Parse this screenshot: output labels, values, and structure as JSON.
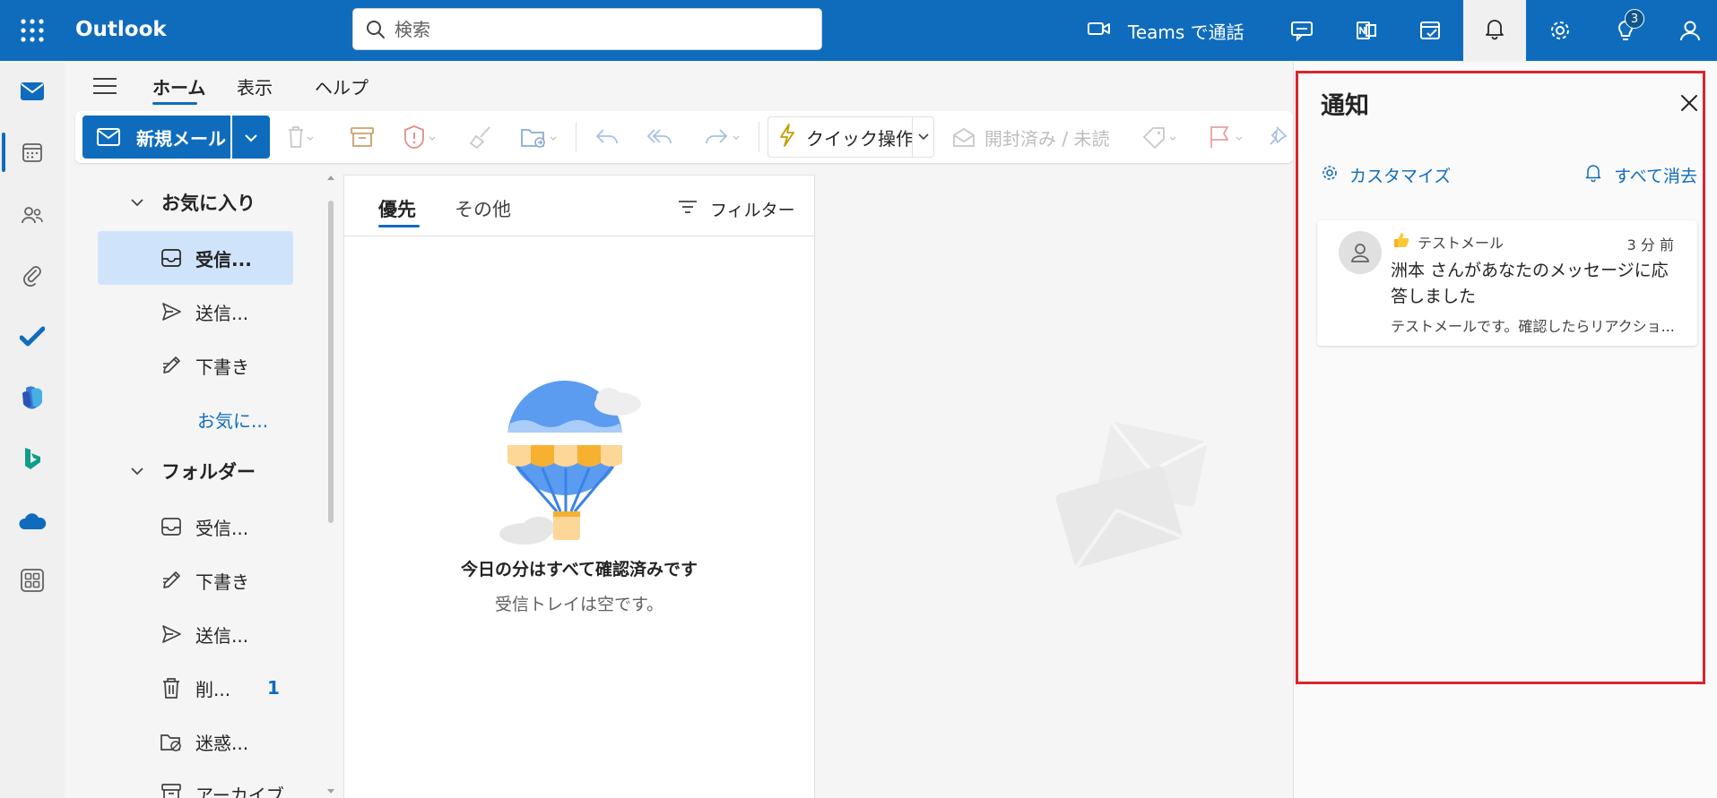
{
  "topbar": {
    "app_name": "Outlook",
    "search_placeholder": "検索",
    "teams_label": "Teams で通話",
    "tips_badge_count": "3",
    "accent_color": "#0f6cbd"
  },
  "ribbon": {
    "tabs": [
      {
        "label": "ホーム",
        "active": true
      },
      {
        "label": "表示",
        "active": false
      },
      {
        "label": "ヘルプ",
        "active": false
      }
    ],
    "new_mail_label": "新規メール",
    "quick_steps_label": "クイック操作",
    "read_unread_label": "開封済み / 未読"
  },
  "folders": {
    "favorites_header": "お気に入り",
    "favorites": [
      {
        "label": "受信...",
        "icon": "inbox-icon",
        "selected": true
      },
      {
        "label": "送信...",
        "icon": "send-icon"
      },
      {
        "label": "下書き",
        "icon": "draft-icon"
      }
    ],
    "add_favorite_link": "お気に...",
    "folders_header": "フォルダー",
    "items": [
      {
        "label": "受信...",
        "icon": "inbox-icon"
      },
      {
        "label": "下書き",
        "icon": "draft-icon"
      },
      {
        "label": "送信...",
        "icon": "send-icon"
      },
      {
        "label": "削...",
        "icon": "trash-icon",
        "count": "1"
      },
      {
        "label": "迷惑...",
        "icon": "junk-icon"
      },
      {
        "label": "アーカイブ",
        "icon": "archive-icon"
      }
    ]
  },
  "message_list": {
    "tabs": [
      {
        "label": "優先",
        "active": true
      },
      {
        "label": "その他",
        "active": false
      }
    ],
    "filter_label": "フィルター",
    "empty_title": "今日の分はすべて確認済みです",
    "empty_subtitle": "受信トレイは空です。"
  },
  "notifications": {
    "title": "通知",
    "customize_label": "カスタマイズ",
    "clear_all_label": "すべて消去",
    "items": [
      {
        "subject": "テストメール",
        "time": "3 分 前",
        "message": "洲本 さんがあなたのメッセージに応答しました",
        "preview": "テストメールです。確認したらリアクショ...",
        "reaction_icon": "thumbs-up-icon"
      }
    ]
  }
}
